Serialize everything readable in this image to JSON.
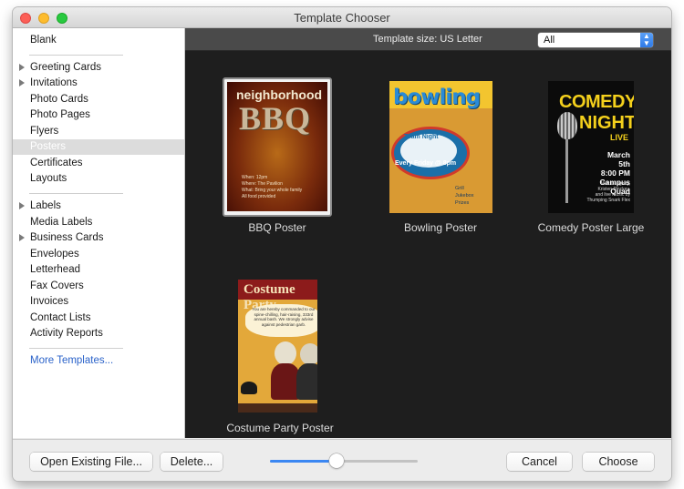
{
  "window": {
    "title": "Template Chooser"
  },
  "sidebar": {
    "items": [
      {
        "label": "Blank"
      },
      {
        "label": "Greeting Cards"
      },
      {
        "label": "Invitations"
      },
      {
        "label": "Photo Cards"
      },
      {
        "label": "Photo Pages"
      },
      {
        "label": "Flyers"
      },
      {
        "label": "Posters"
      },
      {
        "label": "Certificates"
      },
      {
        "label": "Layouts"
      },
      {
        "label": "Labels"
      },
      {
        "label": "Media Labels"
      },
      {
        "label": "Business Cards"
      },
      {
        "label": "Envelopes"
      },
      {
        "label": "Letterhead"
      },
      {
        "label": "Fax Covers"
      },
      {
        "label": "Invoices"
      },
      {
        "label": "Contact Lists"
      },
      {
        "label": "Activity Reports"
      },
      {
        "label": "More Templates..."
      }
    ],
    "selected": "Posters"
  },
  "toolbar": {
    "size_label": "Template size: US Letter",
    "filter_value": "All"
  },
  "templates": [
    {
      "name": "BBQ Poster",
      "art": {
        "line1": "neighborhood",
        "line2": "BBQ",
        "details": "When: 12pm\nWhere: The Pavilion\nWhat: Bring your whole family\nAll food provided"
      }
    },
    {
      "name": "Bowling Poster",
      "art": {
        "line1": "bowling",
        "line2": "Team Night",
        "line3": "Every Friday @ 8pm",
        "list": "Grill\nJukebox\nPrizes"
      }
    },
    {
      "name": "Comedy Poster Large",
      "art": {
        "line1": "COMEDY",
        "line2": "NIGHT",
        "line3": "LIVE",
        "details": "March 5th\n8:00 PM\nCampus Quad",
        "small": "Matt Daughtry,\nKristen Pinckey,\nand live music by\nThumping Snark Flex"
      }
    },
    {
      "name": "Costume Party Poster",
      "art": {
        "line1": "Costume Party",
        "bubble": "You are hereby commanded to our spine-chilling, hair-raising, 333rd annual bash. We strongly advise against pedestrian garb."
      }
    }
  ],
  "footer": {
    "open_label": "Open Existing File...",
    "delete_label": "Delete...",
    "cancel_label": "Cancel",
    "choose_label": "Choose",
    "zoom_fraction": 0.45
  },
  "colors": {
    "accent": "#3b87f2",
    "link": "#2a62c9",
    "selected_row": "#dcdcdc",
    "gallery_bg": "#1e1e1e"
  }
}
